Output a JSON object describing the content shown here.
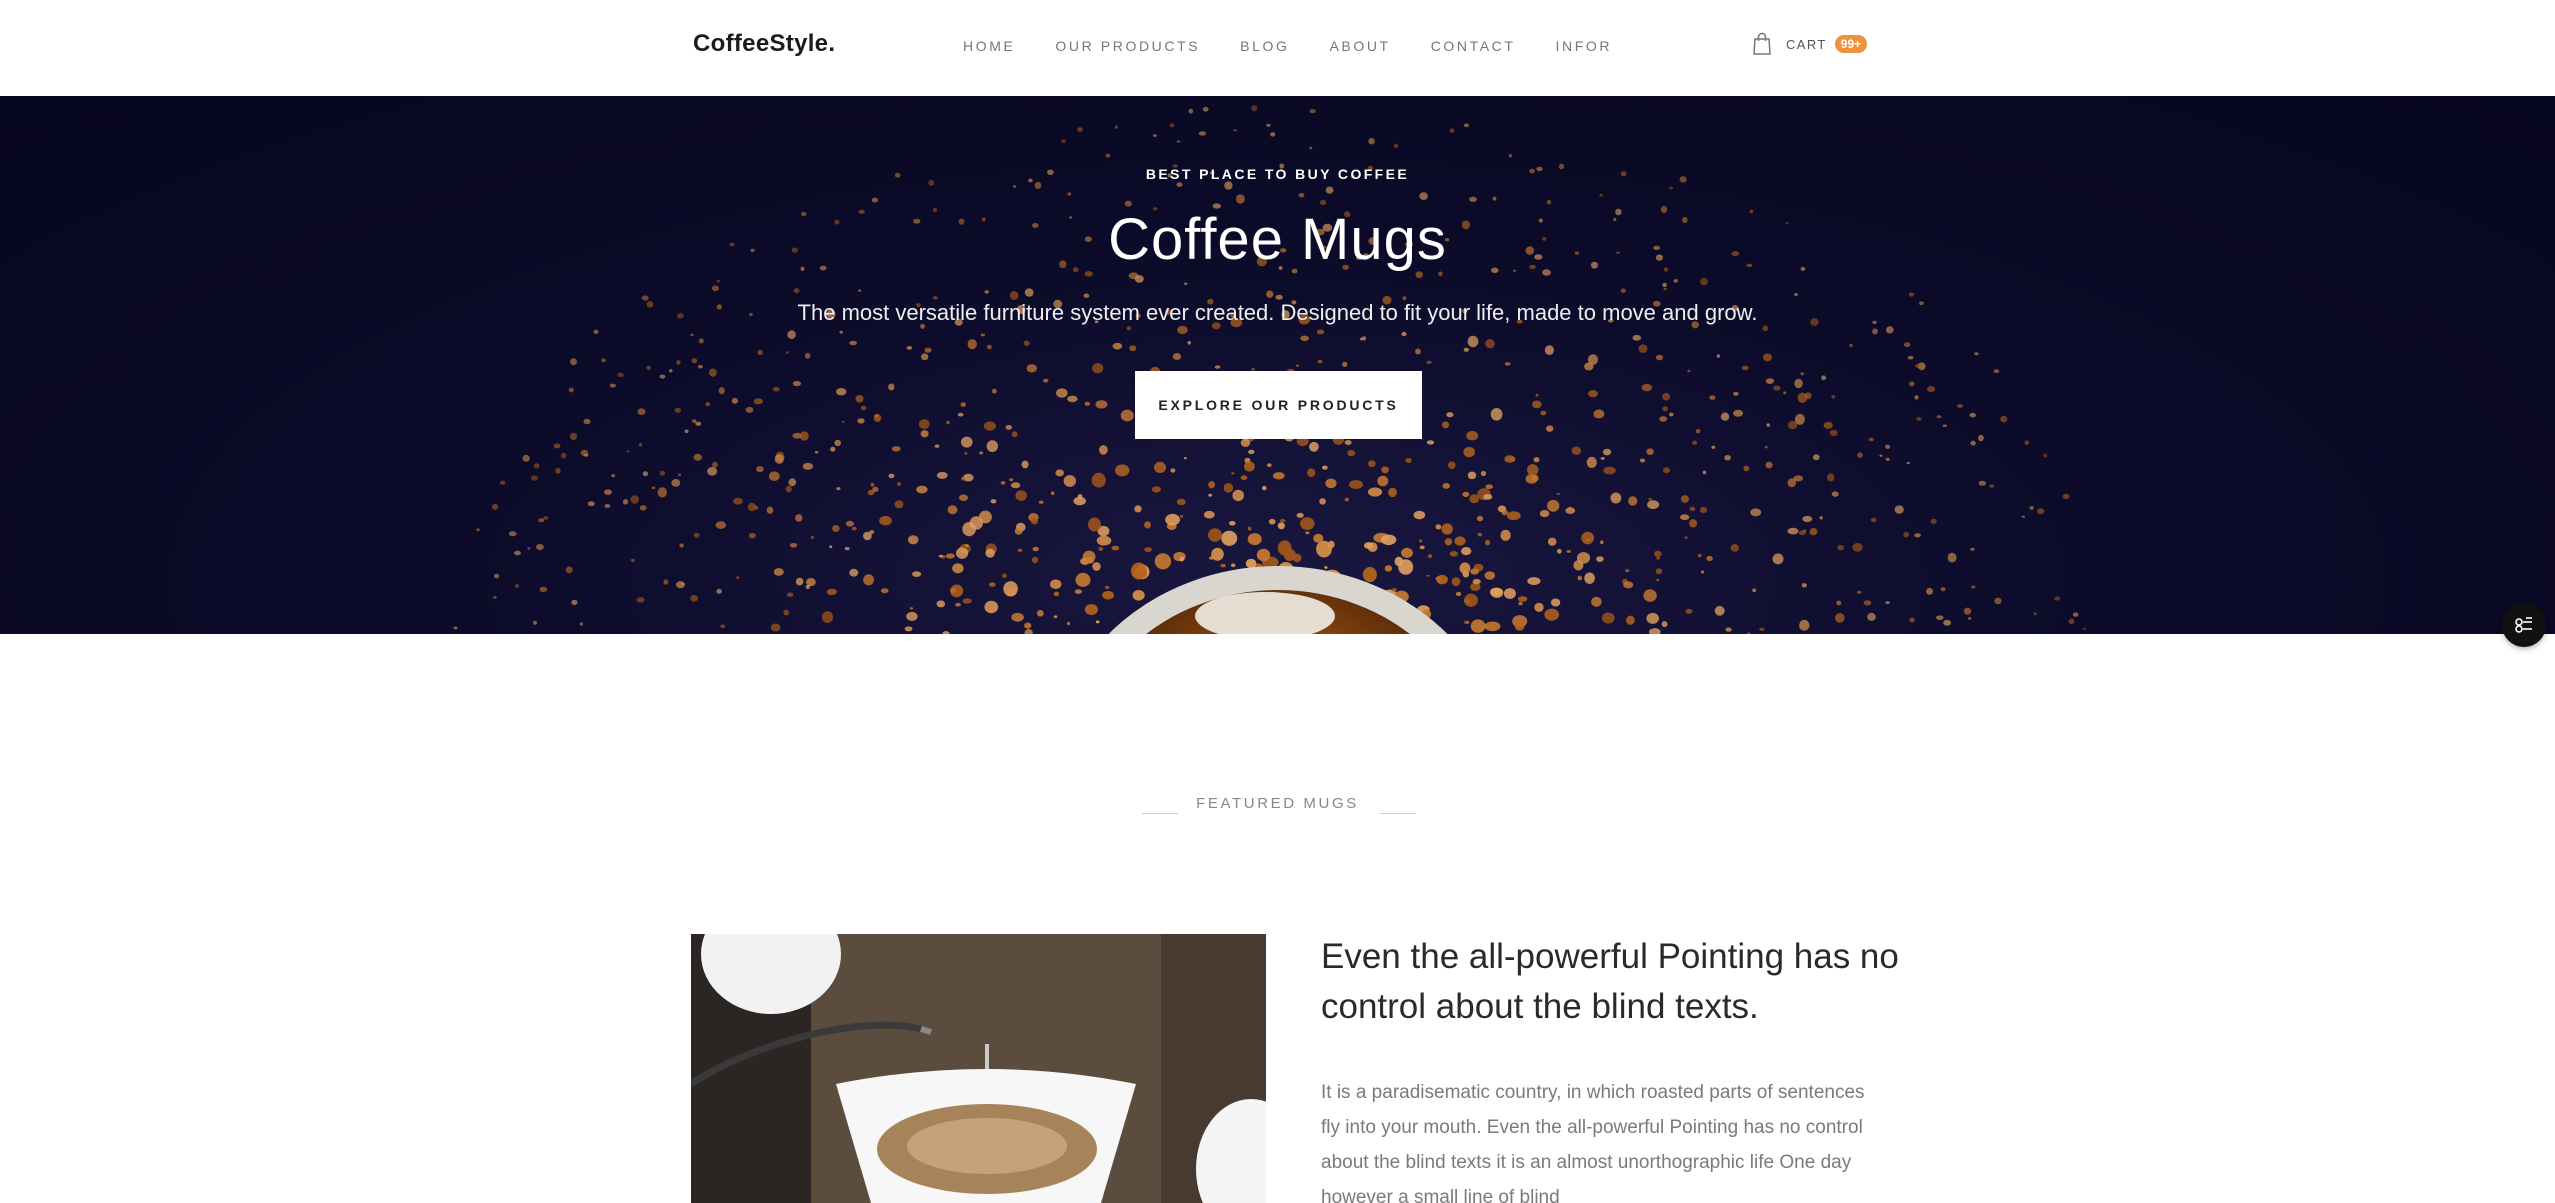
{
  "nav": {
    "brand": "CoffeeStyle.",
    "items": [
      "HOME",
      "OUR PRODUCTS",
      "BLOG",
      "ABOUT",
      "CONTACT",
      "INFOR"
    ],
    "cart_label": "CART",
    "cart_badge": "99+"
  },
  "hero": {
    "kicker": "BEST PLACE TO BUY COFFEE",
    "title": "Coffee Mugs",
    "subtitle": "The most versatile furniture system ever created. Designed to fit your life, made to move and grow.",
    "button": "EXPLORE OUR PRODUCTS"
  },
  "featured": {
    "label": "FEATURED MUGS"
  },
  "article": {
    "title": "Even the all-powerful Pointing has no control about the blind texts.",
    "body": "It is a paradisematic country, in which roasted parts of sentences fly into your mouth. Even the all-powerful Pointing has no control about the blind texts it is an almost unorthographic life One day however a small line of blind"
  },
  "colors": {
    "accent": "#f0923a",
    "hero_bg": "#0c0b2a"
  }
}
